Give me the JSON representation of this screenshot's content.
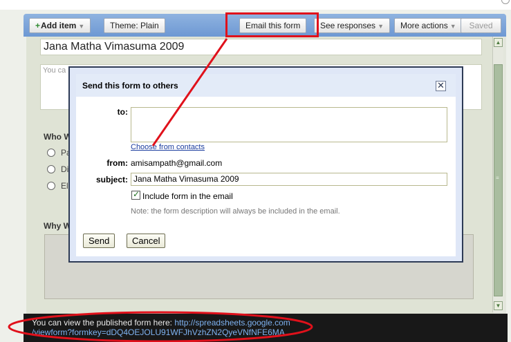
{
  "toolbar": {
    "add_item_label": "Add item",
    "theme_label": "Theme:  Plain",
    "email_form_label": "Email this form",
    "see_responses_label": "See responses",
    "more_actions_label": "More actions",
    "saved_label": "Saved"
  },
  "form": {
    "title": "Jana Matha Vimasuma 2009",
    "description_placeholder": "You ca",
    "question1_label": "Who W",
    "options": [
      "Pa",
      "Di",
      "El"
    ],
    "question2_label": "Why W"
  },
  "dialog": {
    "title": "Send this form to others",
    "to_label": "to:",
    "choose_contacts": "Choose from contacts",
    "from_label": "from:",
    "from_value": "amisampath@gmail.com",
    "subject_label": "subject:",
    "subject_value": "Jana Matha Vimasuma 2009",
    "include_label": "Include form in the email",
    "include_checked": true,
    "note": "Note: the form description will always be included in the email.",
    "send_label": "Send",
    "cancel_label": "Cancel"
  },
  "footer": {
    "message": "You can view the published form here: ",
    "link_line1": "http://spreadsheets.google.com",
    "link_line2": "/viewform?formkey=dDQ4OEJOLU91WFJhVzhZN2QyeVNfNFE6MA"
  },
  "colors": {
    "annotation": "#e0111b",
    "toolbar": "#7aa3d8",
    "dialog_border": "#2d3a55",
    "link": "#1a3c9e"
  }
}
